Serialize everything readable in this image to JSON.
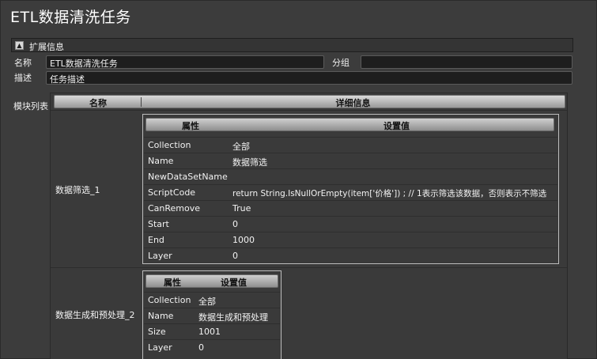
{
  "window": {
    "title": "ETL数据清洗任务"
  },
  "extended_info": {
    "toggle_symbol": "▲",
    "label": "扩展信息"
  },
  "form": {
    "name_label": "名称",
    "name_value": "ETL数据清洗任务",
    "group_label": "分组",
    "group_value": "",
    "desc_label": "描述",
    "desc_value": "任务描述",
    "module_list_label": "模块列表"
  },
  "module_table": {
    "headers": {
      "name": "名称",
      "details": "详细信息"
    },
    "modules": [
      {
        "name": "数据筛选_1",
        "prop_header": {
          "key": "属性",
          "value": "设置值"
        },
        "props": [
          {
            "k": "Collection",
            "v": "全部"
          },
          {
            "k": "Name",
            "v": "数据筛选"
          },
          {
            "k": "NewDataSetName",
            "v": ""
          },
          {
            "k": "ScriptCode",
            "v": "return String.IsNullOrEmpty(item['价格']) ; // 1表示筛选该数据，否则表示不筛选"
          },
          {
            "k": "CanRemove",
            "v": "True"
          },
          {
            "k": "Start",
            "v": "0"
          },
          {
            "k": "End",
            "v": "1000"
          },
          {
            "k": "Layer",
            "v": "0"
          }
        ]
      },
      {
        "name": "数据生成和预处理_2",
        "prop_header": {
          "key": "属性",
          "value": "设置值"
        },
        "props": [
          {
            "k": "Collection",
            "v": "全部"
          },
          {
            "k": "Name",
            "v": "数据生成和预处理"
          },
          {
            "k": "Size",
            "v": "1001"
          },
          {
            "k": "Layer",
            "v": "0"
          }
        ]
      }
    ]
  }
}
